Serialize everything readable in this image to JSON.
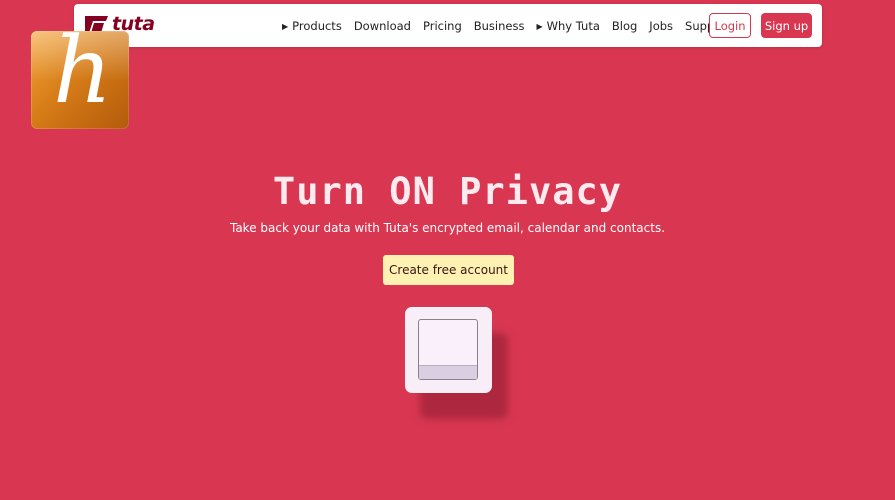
{
  "nav": {
    "logo_text": "tuta",
    "links": [
      {
        "label": "Products",
        "has_arrow": true
      },
      {
        "label": "Download",
        "has_arrow": false
      },
      {
        "label": "Pricing",
        "has_arrow": false
      },
      {
        "label": "Business",
        "has_arrow": false
      },
      {
        "label": "Why Tuta",
        "has_arrow": true
      },
      {
        "label": "Blog",
        "has_arrow": false
      },
      {
        "label": "Jobs",
        "has_arrow": false
      },
      {
        "label": "Support",
        "has_arrow": false
      }
    ],
    "arrow_glyph": "▶",
    "login_label": "Login",
    "signup_label": "Sign up"
  },
  "badge": {
    "letter": "h"
  },
  "hero": {
    "title": "Turn ON Privacy",
    "subtitle": "Take back your data with Tuta's encrypted email, calendar and contacts.",
    "cta_label": "Create free account"
  },
  "colors": {
    "background": "#d93751",
    "brand": "#850122",
    "cta_background": "#fef2b3"
  },
  "icons": {
    "logo": "tuta-logo-icon",
    "switch": "light-switch-icon"
  }
}
